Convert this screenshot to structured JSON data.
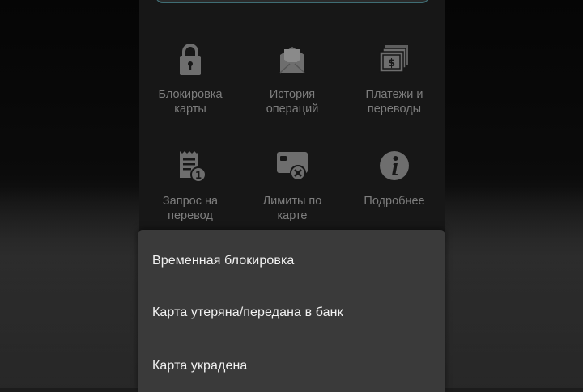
{
  "actions": [
    {
      "label": "Блокировка\nкарты",
      "icon": "lock-icon"
    },
    {
      "label": "История\nопераций",
      "icon": "envelope-icon"
    },
    {
      "label": "Платежи и\nпереводы",
      "icon": "banknotes-icon"
    },
    {
      "label": "Запрос на\nперевод",
      "icon": "request-doc-icon"
    },
    {
      "label": "Лимиты по\nкарте",
      "icon": "card-limit-icon"
    },
    {
      "label": "Подробнее",
      "icon": "info-icon"
    }
  ],
  "block_sheet": {
    "options": [
      "Временная блокировка",
      "Карта утеряна/передана в банк",
      "Карта украдена"
    ]
  },
  "colors": {
    "icon": "#6e6e6e",
    "label": "#7d7d7d",
    "sheet_bg": "#3a3a3a",
    "sheet_text": "#f1f1f1",
    "accent_edge": "#3f6d74"
  }
}
